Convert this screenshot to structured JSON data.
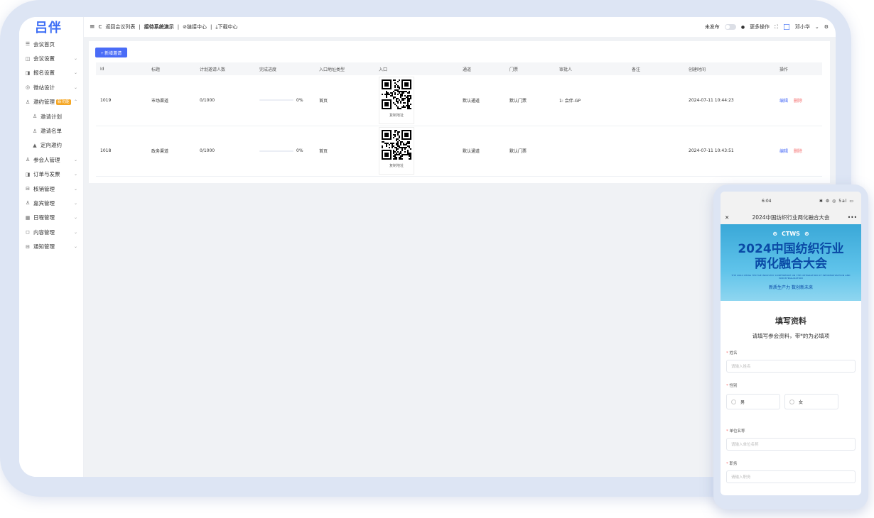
{
  "sidebar": {
    "logo": "吕伴",
    "items": [
      {
        "icon": "home-icon",
        "glyph": "☰",
        "label": "会议首页",
        "chev": false
      },
      {
        "icon": "settings-icon",
        "glyph": "◫",
        "label": "会议设置",
        "chev": true
      },
      {
        "icon": "signup-icon",
        "glyph": "◨",
        "label": "报名设置",
        "chev": true
      },
      {
        "icon": "site-icon",
        "glyph": "◎",
        "label": "微站设计",
        "chev": true
      },
      {
        "icon": "invite-icon",
        "glyph": "♙",
        "label": "邀约管理",
        "badge": "新功能",
        "chev": true,
        "open": true
      },
      {
        "icon": "user-icon",
        "glyph": "♙",
        "label": "邀请计划",
        "sub": true
      },
      {
        "icon": "user-icon",
        "glyph": "♙",
        "label": "邀请名单",
        "sub": true
      },
      {
        "icon": "person-icon",
        "glyph": "▲",
        "label": "定向邀约",
        "sub": true
      },
      {
        "icon": "attendee-icon",
        "glyph": "♙",
        "label": "参会人管理",
        "chev": true
      },
      {
        "icon": "order-icon",
        "glyph": "◨",
        "label": "订单与发票",
        "chev": true
      },
      {
        "icon": "checkin-icon",
        "glyph": "⊟",
        "label": "核销管理",
        "chev": true
      },
      {
        "icon": "guest-icon",
        "glyph": "♙",
        "label": "嘉宾管理",
        "chev": true
      },
      {
        "icon": "calendar-icon",
        "glyph": "▦",
        "label": "日程管理",
        "chev": true
      },
      {
        "icon": "content-icon",
        "glyph": "◻",
        "label": "内容管理",
        "chev": true
      },
      {
        "icon": "notify-icon",
        "glyph": "⊟",
        "label": "通知管理",
        "chev": true
      }
    ]
  },
  "topbar": {
    "menu_glyph": "≡",
    "refresh_glyph": "C",
    "back": "返回会议列表",
    "sep": "|",
    "meeting": "接待系统演示",
    "link_center": "⊘链接中心",
    "download_center": "⤓下载中心",
    "publish_status": "未发布",
    "more_ops": "更多操作",
    "user": "邓小华",
    "chev": "⌄"
  },
  "table": {
    "add_button": "+ 新增邀请",
    "columns": [
      "Id",
      "标题",
      "计划邀请人数",
      "完成进度",
      "入口地址类型",
      "入口",
      "通道",
      "门票",
      "审批人",
      "备注",
      "创建时间",
      "操作"
    ],
    "rows": [
      {
        "id": "1019",
        "title": "市场渠道",
        "plan": "0/1000",
        "progress_pct": 0,
        "progress": "0%",
        "entry_type": "首页",
        "qr_caption": "复制地址",
        "channel": "默认通道",
        "ticket": "默认门票",
        "approver": "1: 会伴-GP",
        "note": "",
        "created": "2024-07-11 10:44:23",
        "edit": "编辑",
        "delete": "删除"
      },
      {
        "id": "1018",
        "title": "政务渠道",
        "plan": "0/1000",
        "progress_pct": 0,
        "progress": "0%",
        "entry_type": "首页",
        "qr_caption": "复制地址",
        "channel": "默认通道",
        "ticket": "默认门票",
        "approver": "",
        "note": "",
        "created": "2024-07-11 10:43:51",
        "edit": "编辑",
        "delete": "删除"
      }
    ]
  },
  "phone": {
    "time": "6:04",
    "signal": "✱ ⚙ ◎ 5al ▭",
    "close": "✕",
    "title": "2024中国纺织行业两化融合大会",
    "more": "•••",
    "brands": [
      "CTWS",
      "⊛",
      "⊛"
    ],
    "banner_title_1": "2024中国纺织行业",
    "banner_title_2": "两化融合大会",
    "banner_en": "THE 2024 CHINA TEXTILE INDUSTRY CONFERENCE ON THE INTEGRATION OF INFORMATIZATION AND INDUSTRIALIZATION",
    "banner_slogan": "新质生产力  数创新未来",
    "form_title": "填写资料",
    "form_hint": "请填写参会资料，带*的为必填项",
    "fields": {
      "name_label": "姓名",
      "name_placeholder": "请输入姓名",
      "gender_label": "性别",
      "male": "男",
      "female": "女",
      "company_label": "单位名称",
      "company_placeholder": "请输入单位名称",
      "title_label": "职务",
      "title_placeholder": "请输入职务"
    }
  },
  "colors": {
    "primary": "#4a6cf7",
    "danger": "#f56c6c",
    "badge": "#f5a623"
  }
}
